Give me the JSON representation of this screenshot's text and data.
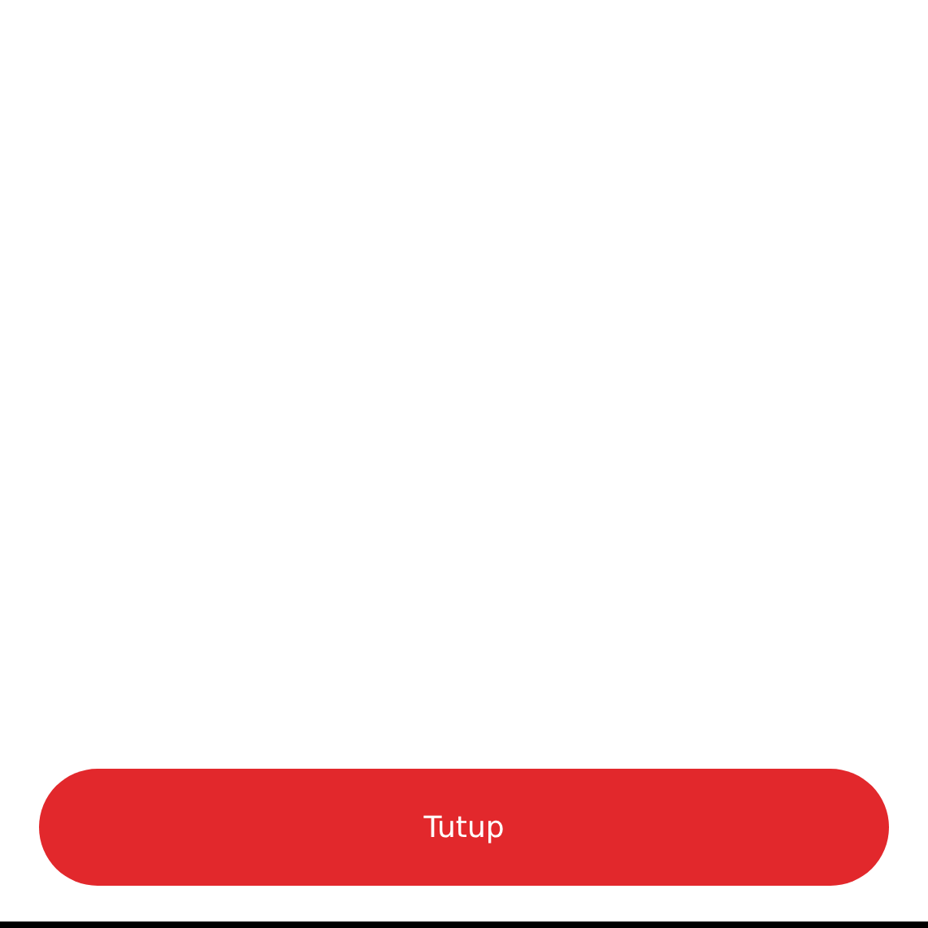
{
  "close_button": {
    "label": "Tutup"
  }
}
